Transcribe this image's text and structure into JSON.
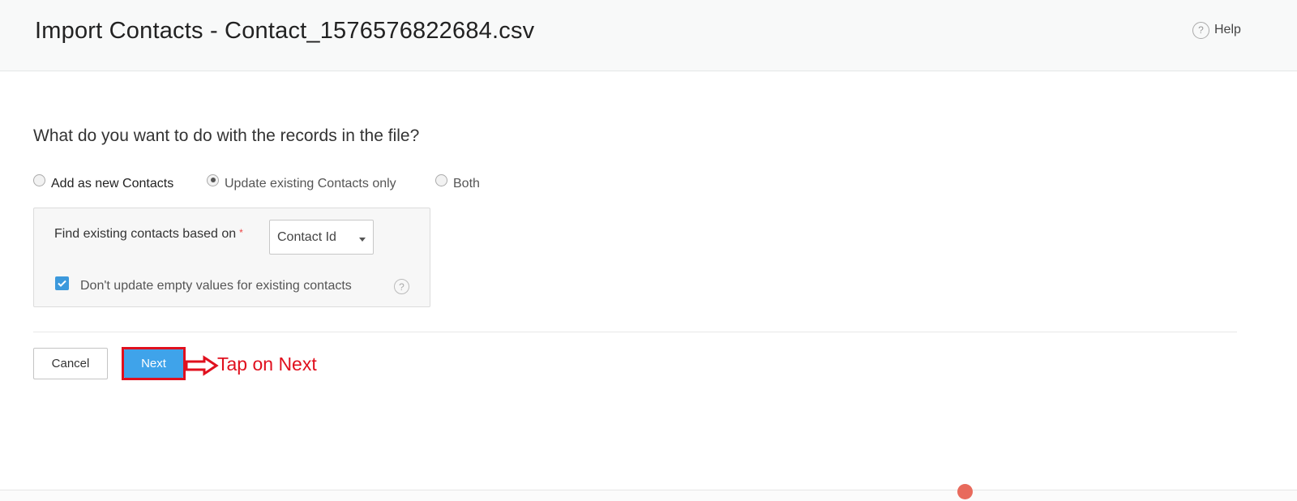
{
  "header": {
    "title": "Import Contacts - Contact_1576576822684.csv",
    "help_label": "Help",
    "help_icon": "question-circle-icon"
  },
  "question": "What do you want to do with the records in the file?",
  "record_action": {
    "options": [
      {
        "label": "Add as new Contacts",
        "checked": false
      },
      {
        "label": "Update existing Contacts only",
        "checked": true
      },
      {
        "label": "Both",
        "checked": false
      }
    ]
  },
  "match_settings": {
    "find_label": "Find existing contacts based on",
    "required_marker": "*",
    "selected_field": "Contact Id",
    "skip_empty_label": "Don't update empty values for existing contacts",
    "skip_empty_checked": true
  },
  "actions": {
    "cancel_label": "Cancel",
    "next_label": "Next"
  },
  "annotation": {
    "text": "Tap on Next",
    "color": "#e0101e"
  },
  "colors": {
    "primary": "#3fa3ea",
    "checkbox": "#3c99dc",
    "highlight": "#e0101e"
  }
}
